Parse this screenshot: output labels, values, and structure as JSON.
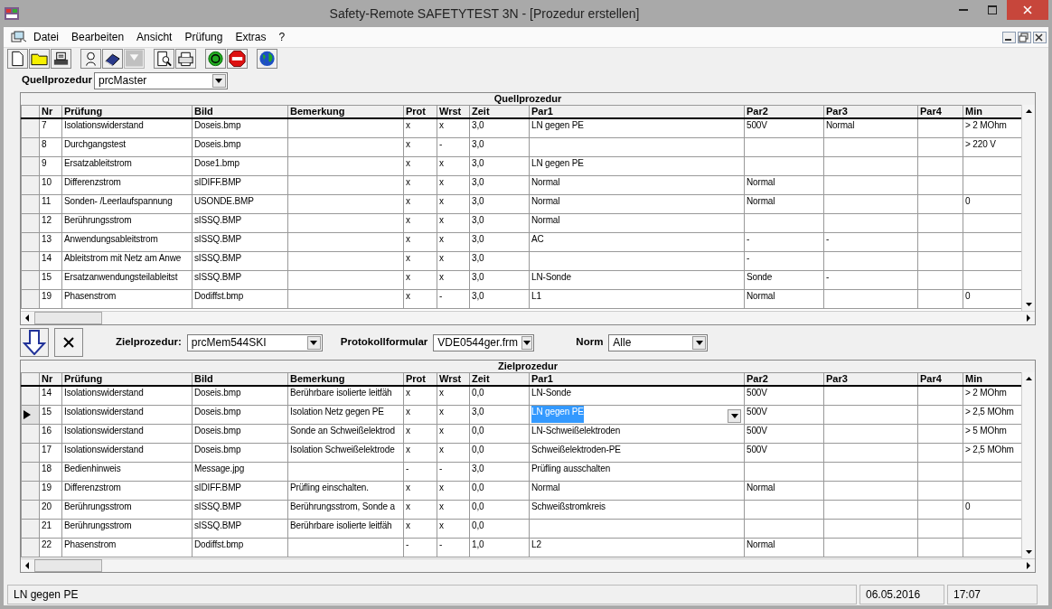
{
  "window": {
    "title": "Safety-Remote SAFETYTEST 3N - [Prozedur erstellen]"
  },
  "menu": [
    "Datei",
    "Bearbeiten",
    "Ansicht",
    "Prüfung",
    "Extras",
    "?"
  ],
  "toolbar": [
    {
      "kind": "new",
      "disabled": false
    },
    {
      "kind": "open",
      "disabled": false
    },
    {
      "kind": "save",
      "disabled": false
    },
    {
      "kind": "gap"
    },
    {
      "kind": "person",
      "disabled": false
    },
    {
      "kind": "eraser",
      "disabled": false
    },
    {
      "kind": "filter",
      "disabled": true
    },
    {
      "kind": "gap"
    },
    {
      "kind": "preview",
      "disabled": false
    },
    {
      "kind": "print",
      "disabled": false
    },
    {
      "kind": "gap"
    },
    {
      "kind": "go",
      "disabled": false
    },
    {
      "kind": "stop",
      "disabled": false
    },
    {
      "kind": "gap"
    },
    {
      "kind": "globe",
      "disabled": false
    }
  ],
  "source": {
    "label": "Quellprozedur",
    "value": "prcMaster"
  },
  "source_grid": {
    "title": "Quellprozedur",
    "columns": [
      "Nr",
      "Prüfung",
      "Bild",
      "Bemerkung",
      "Prot",
      "Wrst",
      "Zeit",
      "Par1",
      "Par2",
      "Par3",
      "Par4",
      "Min"
    ],
    "rows": [
      {
        "nr": "7",
        "pruefung": "Isolationswiderstand",
        "bild": "Doseis.bmp",
        "prot": "x",
        "wrst": "x",
        "zeit": "3,0",
        "par1": "LN gegen PE",
        "par2": "500V",
        "par3": "Normal",
        "min": "> 2 MOhm"
      },
      {
        "nr": "8",
        "pruefung": "Durchgangstest",
        "bild": "Doseis.bmp",
        "prot": "x",
        "wrst": "-",
        "zeit": "3,0",
        "min": "> 220 V"
      },
      {
        "nr": "9",
        "pruefung": "Ersatzableitstrom",
        "bild": "Dose1.bmp",
        "prot": "x",
        "wrst": "x",
        "zeit": "3,0",
        "par1": "LN gegen PE"
      },
      {
        "nr": "10",
        "pruefung": "Differenzstrom",
        "bild": "sIDIFF.BMP",
        "prot": "x",
        "wrst": "x",
        "zeit": "3,0",
        "par1": "Normal",
        "par2": "Normal"
      },
      {
        "nr": "11",
        "pruefung": "Sonden- /Leerlaufspannung",
        "bild": "USONDE.BMP",
        "prot": "x",
        "wrst": "x",
        "zeit": "3,0",
        "par1": "Normal",
        "par2": "Normal",
        "min": "0"
      },
      {
        "nr": "12",
        "pruefung": "Berührungsstrom",
        "bild": "sISSQ.BMP",
        "prot": "x",
        "wrst": "x",
        "zeit": "3,0",
        "par1": "Normal"
      },
      {
        "nr": "13",
        "pruefung": "Anwendungsableitstrom",
        "bild": "sISSQ.BMP",
        "prot": "x",
        "wrst": "x",
        "zeit": "3,0",
        "par1": "AC",
        "par2": "-",
        "par3": "-"
      },
      {
        "nr": "14",
        "pruefung": "Ableitstrom mit Netz am Anwe",
        "bild": "sISSQ.BMP",
        "prot": "x",
        "wrst": "x",
        "zeit": "3,0",
        "par2": "-"
      },
      {
        "nr": "15",
        "pruefung": "Ersatzanwendungsteilableitst",
        "bild": "sISSQ.BMP",
        "prot": "x",
        "wrst": "x",
        "zeit": "3,0",
        "par1": "LN-Sonde",
        "par2": "Sonde",
        "par3": "-"
      },
      {
        "nr": "19",
        "pruefung": "Phasenstrom",
        "bild": "Dodiffst.bmp",
        "prot": "x",
        "wrst": "-",
        "zeit": "3,0",
        "par1": "L1",
        "par2": "Normal",
        "min": "0"
      }
    ]
  },
  "target": {
    "label": "Zielprozedur:",
    "value": "prcMem544SKI"
  },
  "protocol": {
    "label": "Protokollformular",
    "value": "VDE0544ger.frm"
  },
  "norm": {
    "label": "Norm",
    "value": "Alle"
  },
  "target_grid": {
    "title": "Zielprozedur",
    "columns": [
      "Nr",
      "Prüfung",
      "Bild",
      "Bemerkung",
      "Prot",
      "Wrst",
      "Zeit",
      "Par1",
      "Par2",
      "Par3",
      "Par4",
      "Min"
    ],
    "rows": [
      {
        "selected": false,
        "nr": "14",
        "pruefung": "Isolationswiderstand",
        "bild": "Doseis.bmp",
        "bemerkung": "Berührbare isolierte leitfäh",
        "prot": "x",
        "wrst": "x",
        "zeit": "0,0",
        "par1": "LN-Sonde",
        "par2": "500V",
        "min": "> 2 MOhm"
      },
      {
        "selected": true,
        "nr": "15",
        "pruefung": "Isolationswiderstand",
        "bild": "Doseis.bmp",
        "bemerkung": "Isolation Netz gegen PE",
        "prot": "x",
        "wrst": "x",
        "zeit": "3,0",
        "par1": "LN gegen PE",
        "par2": "500V",
        "min": "> 2,5 MOhm"
      },
      {
        "selected": false,
        "nr": "16",
        "pruefung": "Isolationswiderstand",
        "bild": "Doseis.bmp",
        "bemerkung": "Sonde an Schweißelektrod",
        "prot": "x",
        "wrst": "x",
        "zeit": "0,0",
        "par1": "LN-Schweißelektroden",
        "par2": "500V",
        "min": "> 5 MOhm"
      },
      {
        "selected": false,
        "nr": "17",
        "pruefung": "Isolationswiderstand",
        "bild": "Doseis.bmp",
        "bemerkung": "Isolation Schweißelektrode",
        "prot": "x",
        "wrst": "x",
        "zeit": "0,0",
        "par1": "Schweißelektroden-PE",
        "par2": "500V",
        "min": "> 2,5 MOhm"
      },
      {
        "selected": false,
        "nr": "18",
        "pruefung": "Bedienhinweis",
        "bild": "Message.jpg",
        "prot": "-",
        "wrst": "-",
        "zeit": "3,0",
        "par1": "Prüfling ausschalten"
      },
      {
        "selected": false,
        "nr": "19",
        "pruefung": "Differenzstrom",
        "bild": "sIDIFF.BMP",
        "bemerkung": "Prüfling einschalten.",
        "prot": "x",
        "wrst": "x",
        "zeit": "0,0",
        "par1": "Normal",
        "par2": "Normal"
      },
      {
        "selected": false,
        "nr": "20",
        "pruefung": "Berührungsstrom",
        "bild": "sISSQ.BMP",
        "bemerkung": "Berührungsstrom, Sonde a",
        "prot": "x",
        "wrst": "x",
        "zeit": "0,0",
        "par1": "Schweißstromkreis",
        "min": "0"
      },
      {
        "selected": false,
        "nr": "21",
        "pruefung": "Berührungsstrom",
        "bild": "sISSQ.BMP",
        "bemerkung": "Berührbare isolierte leitfäh",
        "prot": "x",
        "wrst": "x",
        "zeit": "0,0"
      },
      {
        "selected": false,
        "nr": "22",
        "pruefung": "Phasenstrom",
        "bild": "Dodiffst.bmp",
        "prot": "-",
        "wrst": "-",
        "zeit": "1,0",
        "par1": "L2",
        "par2": "Normal"
      }
    ]
  },
  "status_bar": [
    "LN gegen PE",
    "06.05.2016",
    "17:07"
  ]
}
